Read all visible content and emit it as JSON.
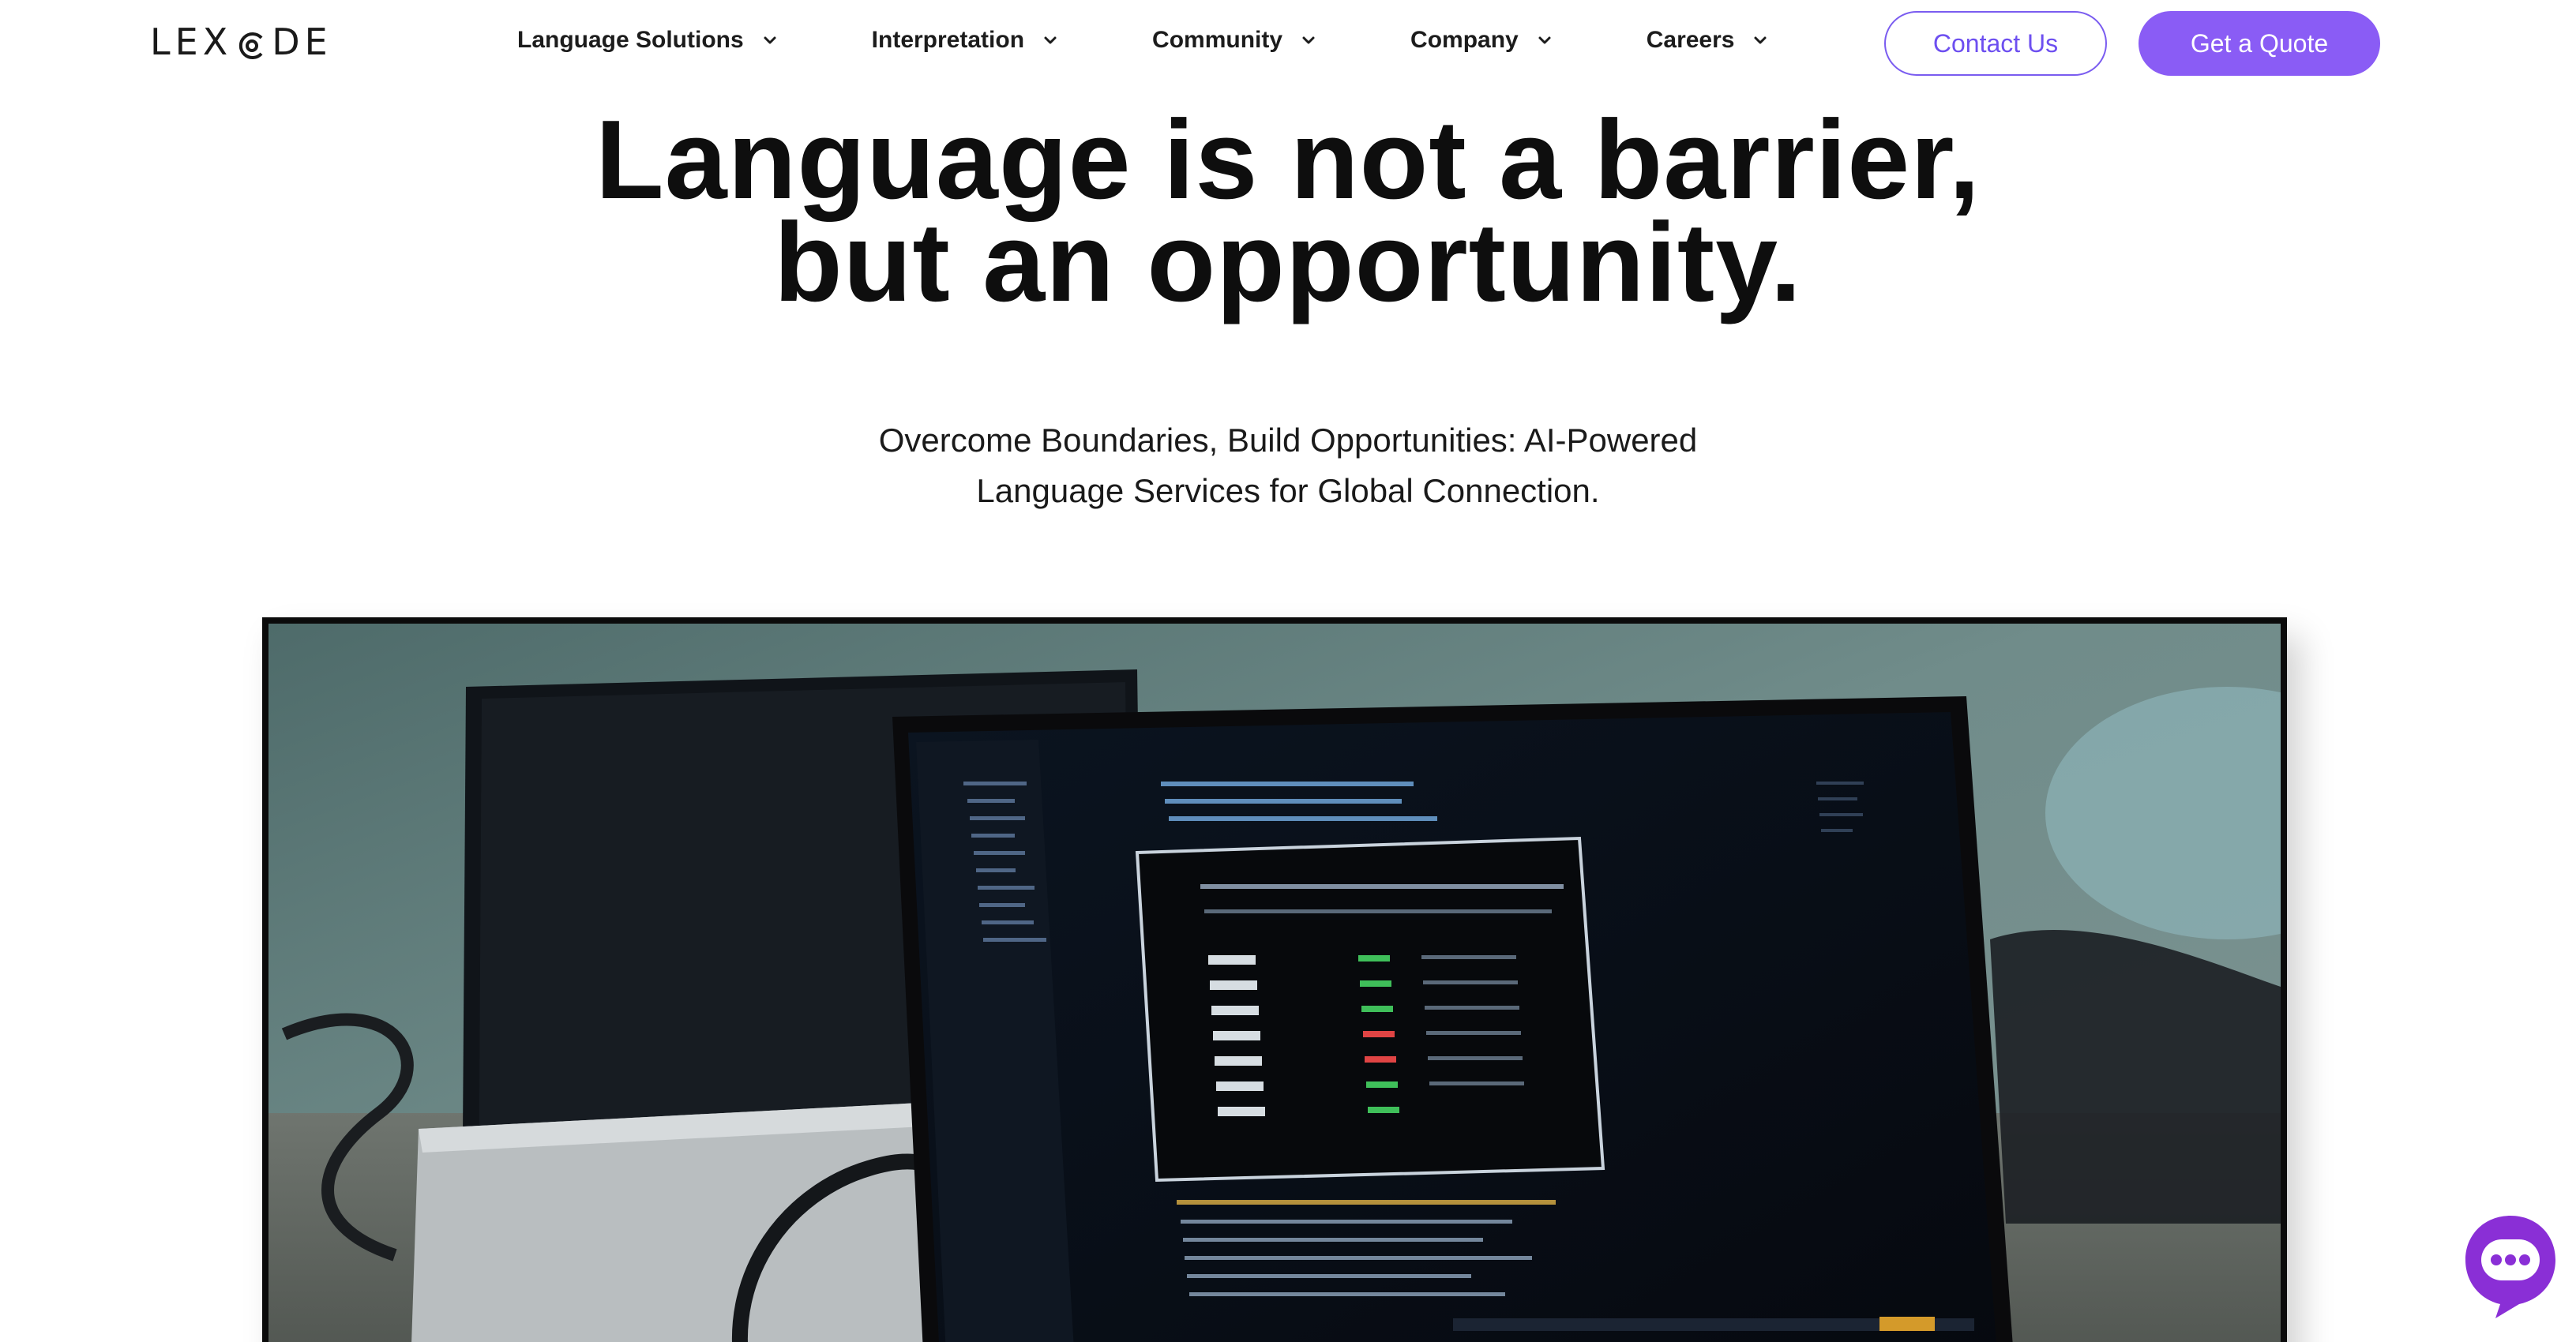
{
  "brand": {
    "logo_text_left": "LEX",
    "logo_text_right": "DE",
    "logo_icon": "lexcode-logo-icon"
  },
  "nav": {
    "items": [
      {
        "label": "Language Solutions",
        "icon": "chevron-down-icon"
      },
      {
        "label": "Interpretation",
        "icon": "chevron-down-icon"
      },
      {
        "label": "Community",
        "icon": "chevron-down-icon"
      },
      {
        "label": "Company",
        "icon": "chevron-down-icon"
      },
      {
        "label": "Careers",
        "icon": "chevron-down-icon"
      }
    ],
    "contact_label": "Contact Us",
    "quote_label": "Get a Quote"
  },
  "hero": {
    "title_line1": "Language is not a barrier,",
    "title_line2": "but an opportunity.",
    "subtitle_line1": "Overcome Boundaries, Build Opportunities: AI-Powered",
    "subtitle_line2": "Language Services for Global Connection."
  },
  "video": {
    "content": "laptop-with-code-editor-video"
  },
  "chat": {
    "icon": "chat-bubble-icon"
  },
  "colors": {
    "accent": "#8a5cf5",
    "accent_border": "#7a5cf0",
    "text": "#111111",
    "background": "#ffffff"
  }
}
